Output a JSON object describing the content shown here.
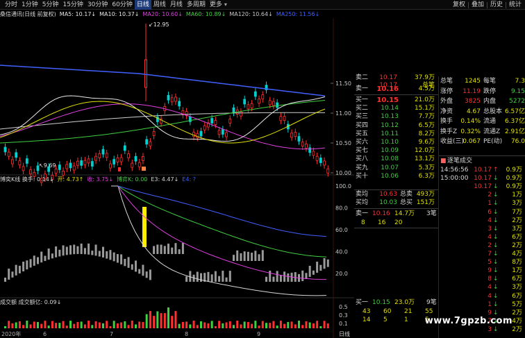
{
  "toolbar": {
    "periods": [
      {
        "label": "分时",
        "active": false
      },
      {
        "label": "1分钟",
        "active": false
      },
      {
        "label": "5分钟",
        "active": false
      },
      {
        "label": "15分钟",
        "active": false
      },
      {
        "label": "30分钟",
        "active": false
      },
      {
        "label": "60分钟",
        "active": false
      },
      {
        "label": "日线",
        "active": true
      },
      {
        "label": "周线",
        "active": false
      },
      {
        "label": "月线",
        "active": false
      },
      {
        "label": "多周期",
        "active": false
      },
      {
        "label": "更多",
        "active": false
      }
    ],
    "right_items": [
      "复权",
      "叠加",
      "历史",
      "统计"
    ],
    "more_arrow": "▾"
  },
  "ma_line": {
    "title": "桑信通讯(日线 前复权)",
    "items": [
      {
        "text": "MA5: 10.17↓",
        "color": "#e8e8e8"
      },
      {
        "text": "MA10: 10.37↓",
        "color": "#e8e8e8"
      },
      {
        "text": "MA20: 10.60↓",
        "color": "#e040e0"
      },
      {
        "text": "MA60: 10.89↓",
        "color": "#40d040"
      },
      {
        "text": "MA120: 10.64↓",
        "color": "#c8c8c8"
      },
      {
        "text": "MA250: 11.56↓",
        "color": "#4060ff"
      }
    ]
  },
  "macd_line": {
    "items": [
      {
        "text": "博奕K线  换手: 0.14↓",
        "color": "#d8d8d8"
      },
      {
        "text": "开: 4.73↑",
        "color": "#e0e000"
      },
      {
        "text": "收: 3.75↓",
        "color": "#e040e0"
      },
      {
        "text": "博弈K: 0.00",
        "color": "#40d040"
      },
      {
        "text": "E3: 4.47↓",
        "color": "#d8d8d8"
      },
      {
        "text": "E4: ?",
        "color": "#4060ff"
      }
    ]
  },
  "vol_line": {
    "items": [
      {
        "text": "成交额  成交额亿: 0.09↓",
        "color": "#d8d8d8"
      }
    ]
  },
  "chart_labels": {
    "high_price": "12.95",
    "low_price": "9.69",
    "price_ticks": [
      "11.50",
      "11.00",
      "10.50",
      "10.00"
    ],
    "ind_ticks": [
      "100.0",
      "80.0",
      "60.0",
      "40.0",
      "20.0"
    ],
    "vol_ticks": [
      "0.5",
      "0.3",
      "0.1"
    ],
    "date_labels": [
      "2020年",
      "6",
      "7",
      "8",
      "9"
    ],
    "period_tag": "日线"
  },
  "quote": {
    "partial_top": [
      {
        "label": "卖二",
        "price": "10.17",
        "vol": "37.9万"
      },
      {
        "label": "",
        "price": "10.17",
        "vol": "总笔"
      }
    ],
    "sells": [
      {
        "label": "卖一",
        "price": "10.16",
        "vol": "4.5万"
      }
    ],
    "buys": [
      {
        "label": "买一",
        "price": "10.15",
        "vol": "21.0万"
      },
      {
        "label": "买二",
        "price": "10.14",
        "vol": "15.1万"
      },
      {
        "label": "买三",
        "price": "10.13",
        "vol": "7.7万"
      },
      {
        "label": "买四",
        "price": "10.12",
        "vol": "6.5万"
      },
      {
        "label": "买五",
        "price": "10.11",
        "vol": "8.2万"
      },
      {
        "label": "买六",
        "price": "10.10",
        "vol": "9.6万"
      },
      {
        "label": "买七",
        "price": "10.09",
        "vol": "12.0万"
      },
      {
        "label": "买八",
        "price": "10.08",
        "vol": "13.1万"
      },
      {
        "label": "买九",
        "price": "10.07",
        "vol": "5.3万"
      },
      {
        "label": "买十",
        "price": "10.06",
        "vol": "6.3万"
      }
    ],
    "avg": [
      {
        "label": "卖均",
        "price": "10.63",
        "label2": "总卖",
        "vol": "493万"
      },
      {
        "label": "买均",
        "price": "10.03",
        "label2": "总买",
        "vol": "151万"
      }
    ],
    "queue_sell": {
      "label": "卖一",
      "price": "10.16",
      "vol": "14.7万",
      "count": "3笔"
    },
    "queue_sell_nums": [
      "8",
      "16",
      "20"
    ],
    "queue_buy": {
      "label": "买一",
      "price": "10.15",
      "vol": "23.0万",
      "count": "9笔"
    },
    "queue_buy_nums": [
      [
        "43",
        "60",
        "21",
        "55"
      ],
      [
        "14",
        "5",
        "1",
        "5"
      ]
    ]
  },
  "stats": {
    "rows": [
      {
        "l1": "总笔",
        "v1": "1245",
        "l2": "每笔",
        "v2": "7.3"
      },
      {
        "l1": "涨停",
        "v1": "11.19",
        "l2": "跌停",
        "v2": "9.15"
      },
      {
        "l1": "外盘",
        "v1": "3825",
        "l2": "内盘",
        "v2": "5272"
      },
      {
        "l1": "净资",
        "v1": "4.67",
        "l2": "总股本",
        "v2": "6.57亿"
      },
      {
        "l1": "换手",
        "v1": "0.14%",
        "l2": "流通",
        "v2": "6.37亿"
      },
      {
        "l1": "换手Z",
        "v1": "0.32%",
        "l2": "流通Z",
        "v2": "2.91亿"
      },
      {
        "l1": "收益(三)",
        "v1": "0.067",
        "l2": "PE(动)",
        "v2": "76.0"
      }
    ]
  },
  "ticks": {
    "title": "逐笔成交",
    "rows": [
      {
        "time": "14:56:56",
        "price": "10.17",
        "vol": "0.9万",
        "dir": "up"
      },
      {
        "time": "15:00:00",
        "price": "10.17",
        "vol": "0.9万",
        "dir": "down"
      },
      {
        "time": "",
        "price": "10.17",
        "vol": "0.9万",
        "dir": "down"
      },
      {
        "time": "",
        "price": "2",
        "vol": "1万",
        "dir": "down"
      },
      {
        "time": "",
        "price": "1",
        "vol": "3万",
        "dir": "down"
      },
      {
        "time": "",
        "price": "6",
        "vol": "7万",
        "dir": "down"
      },
      {
        "time": "",
        "price": "4",
        "vol": "2万",
        "dir": "down"
      },
      {
        "time": "",
        "price": "3",
        "vol": "3万",
        "dir": "down"
      },
      {
        "time": "",
        "price": "4",
        "vol": "6万",
        "dir": "down"
      },
      {
        "time": "",
        "price": "2",
        "vol": "2万",
        "dir": "down"
      },
      {
        "time": "",
        "price": "7",
        "vol": "4万",
        "dir": "down"
      },
      {
        "time": "",
        "price": "5",
        "vol": "8万",
        "dir": "down"
      },
      {
        "time": "",
        "price": "9",
        "vol": "1万",
        "dir": "down"
      },
      {
        "time": "",
        "price": "8",
        "vol": "6万",
        "dir": "down"
      },
      {
        "time": "",
        "price": "4",
        "vol": "3万",
        "dir": "down"
      },
      {
        "time": "",
        "price": "4",
        "vol": "6万",
        "dir": "down"
      },
      {
        "time": "",
        "price": "1",
        "vol": "5万",
        "dir": "down"
      },
      {
        "time": "",
        "price": "9",
        "vol": "2万",
        "dir": "down"
      },
      {
        "time": "",
        "price": "7",
        "vol": "4万",
        "dir": "down"
      },
      {
        "time": "",
        "price": "3",
        "vol": "2万",
        "dir": "down"
      }
    ]
  },
  "watermark": "www.7gpzb.com",
  "colors": {
    "up": "#ff3030",
    "down": "#00d0d0",
    "ma5": "#e8e8e8",
    "ma20": "#e040e0",
    "ma60": "#40d040",
    "ma250": "#4060ff",
    "highlight": "#ffee00"
  }
}
